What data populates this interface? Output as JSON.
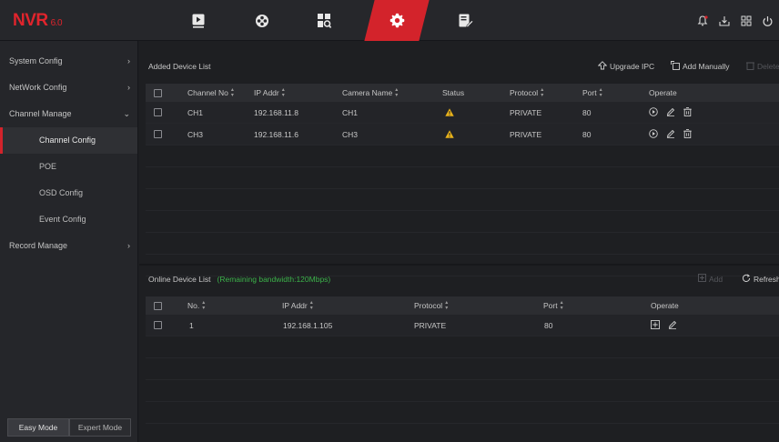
{
  "app": {
    "brand": "NVR",
    "version": "6.0"
  },
  "nav": [
    {
      "name": "playback-icon"
    },
    {
      "name": "live-view-icon"
    },
    {
      "name": "search-icon"
    },
    {
      "name": "settings-icon",
      "active": true
    },
    {
      "name": "maintenance-icon"
    }
  ],
  "system_icons": [
    "alarm-icon",
    "backup-icon",
    "layout-icon",
    "power-icon"
  ],
  "sidebar": {
    "items": [
      {
        "label": "System Config"
      },
      {
        "label": "NetWork Config"
      },
      {
        "label": "Channel Manage"
      },
      {
        "label": "Record Manage"
      }
    ],
    "subitems": [
      {
        "label": "Channel Config"
      },
      {
        "label": "POE"
      },
      {
        "label": "OSD Config"
      },
      {
        "label": "Event Config"
      }
    ],
    "modes": {
      "easy": "Easy Mode",
      "expert": "Expert Mode"
    }
  },
  "added": {
    "title": "Added Device List",
    "actions": {
      "upgrade": "Upgrade IPC",
      "add_manually": "Add Manually",
      "delete": "Delete"
    },
    "columns": [
      "Channel No",
      "IP Addr",
      "Camera Name",
      "Status",
      "Protocol",
      "Port",
      "Operate"
    ],
    "rows": [
      {
        "channel": "CH1",
        "ip": "192.168.11.8",
        "camera": "CH1",
        "protocol": "PRIVATE",
        "port": "80"
      },
      {
        "channel": "CH3",
        "ip": "192.168.11.6",
        "camera": "CH3",
        "protocol": "PRIVATE",
        "port": "80"
      }
    ]
  },
  "online": {
    "title": "Online Device List",
    "hint": "(Remaining bandwidth:120Mbps)",
    "actions": {
      "add": "Add",
      "refresh": "Refresh"
    },
    "columns": [
      "No.",
      "IP Addr",
      "Protocol",
      "Port",
      "Operate"
    ],
    "rows": [
      {
        "no": "1",
        "ip": "192.168.1.105",
        "protocol": "PRIVATE",
        "port": "80"
      }
    ]
  },
  "colors": {
    "accent": "#d3232b",
    "warning": "#e8b21a",
    "hint": "#3cb24a"
  }
}
